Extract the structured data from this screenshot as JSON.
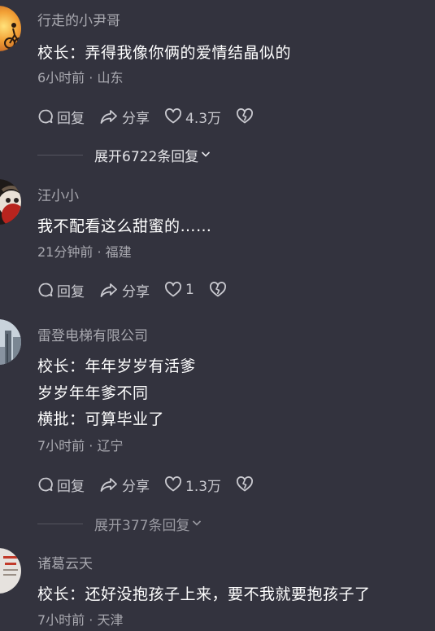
{
  "comments": [
    {
      "username": "行走的小尹哥",
      "lines": [
        "校长：弄得我像你俩的爱情结晶似的"
      ],
      "meta": "6小时前 · 山东",
      "reply_label": "回复",
      "share_label": "分享",
      "like_count": "4.3万",
      "expand_label": "展开6722条回复"
    },
    {
      "username": "汪小小",
      "lines": [
        "我不配看这么甜蜜的……"
      ],
      "meta": "21分钟前 · 福建",
      "reply_label": "回复",
      "share_label": "分享",
      "like_count": "1"
    },
    {
      "username": "雷登电梯有限公司",
      "lines": [
        "校长：年年岁岁有活爹",
        "岁岁年年爹不同",
        "横批：可算毕业了"
      ],
      "meta": "7小时前 · 辽宁",
      "reply_label": "回复",
      "share_label": "分享",
      "like_count": "1.3万",
      "expand_label": "展开377条回复"
    },
    {
      "username": "诸葛云天",
      "lines": [
        "校长：还好没抱孩子上来，要不我就要抱孩子了"
      ],
      "meta": "7小时前 · 天津"
    }
  ],
  "colors": {
    "background": "#33333e",
    "username": "#a9a9b0",
    "content": "#ffffff",
    "meta": "#a9a9b0",
    "action": "#c9c9cf",
    "expand_bright": "#e4e4e8",
    "expand_dim": "#9a9aa2"
  },
  "icons": {
    "reply": "comment-bubble-icon",
    "share": "share-arrow-icon",
    "like": "heart-icon",
    "dislike": "broken-heart-icon",
    "expand": "chevron-down-icon"
  }
}
